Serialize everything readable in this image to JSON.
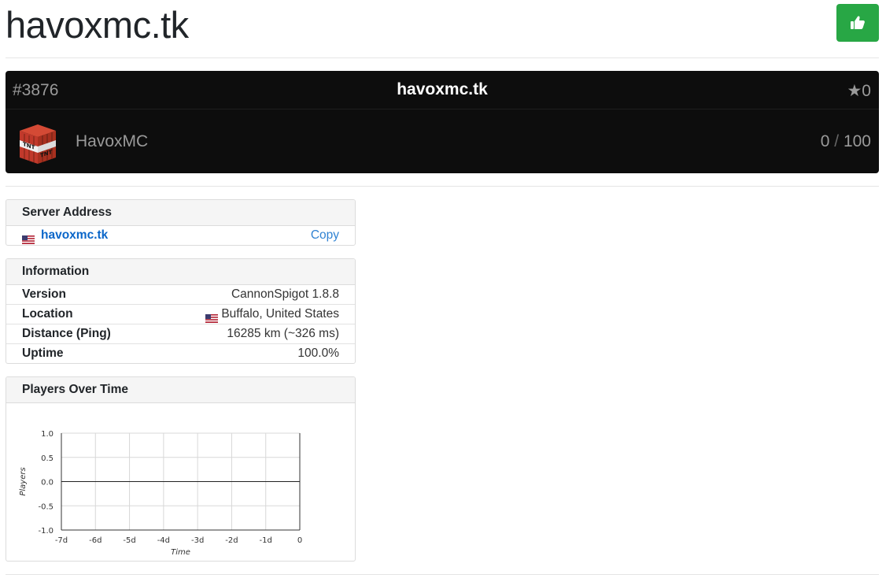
{
  "header": {
    "title": "havoxmc.tk",
    "like_icon": "thumbs-up-icon"
  },
  "banner": {
    "rank": "#3876",
    "title": "havoxmc.tk",
    "stars": "★0",
    "server_name": "HavoxMC",
    "players_online": "0",
    "players_sep": "/",
    "players_max": "100",
    "icon": "tnt-block-icon"
  },
  "server_address": {
    "header": "Server Address",
    "address": "havoxmc.tk",
    "copy_label": "Copy",
    "flag": "us-flag-icon"
  },
  "information": {
    "header": "Information",
    "rows": [
      {
        "label": "Version",
        "value": "CannonSpigot 1.8.8"
      },
      {
        "label": "Location",
        "value": "Buffalo, United States"
      },
      {
        "label": "Distance (Ping)",
        "value": "16285 km (~326 ms)"
      },
      {
        "label": "Uptime",
        "value": "100.0%"
      }
    ]
  },
  "players_chart": {
    "header": "Players Over Time"
  },
  "chart_data": {
    "type": "line",
    "title": "",
    "xlabel": "Time",
    "ylabel": "Players",
    "x_ticks": [
      "-7d",
      "-6d",
      "-5d",
      "-4d",
      "-3d",
      "-2d",
      "-1d",
      "0"
    ],
    "y_ticks": [
      "1.0",
      "0.5",
      "0.0",
      "-0.5",
      "-1.0"
    ],
    "xlim": [
      -7,
      0
    ],
    "ylim": [
      -1,
      1
    ],
    "series": [
      {
        "x": [
          -7,
          0
        ],
        "y": [
          0,
          0
        ]
      }
    ],
    "grid": true
  },
  "colors": {
    "accent": "#28a745",
    "banner_bg": "#0d0d0d",
    "link": "#0a66c9"
  }
}
